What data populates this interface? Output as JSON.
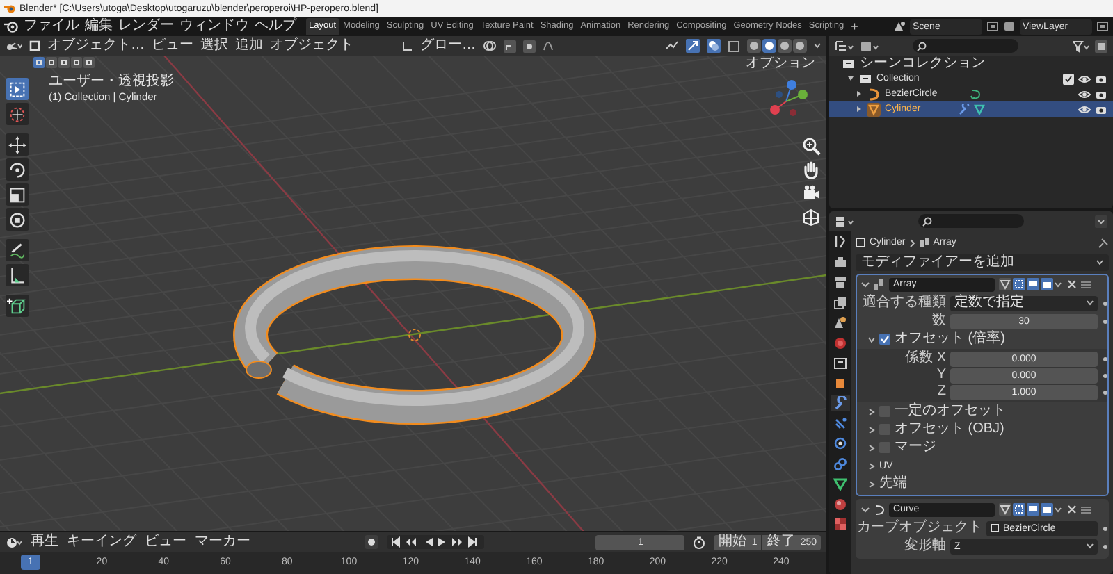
{
  "window": {
    "title": "Blender* [C:\\Users\\utoga\\Desktop\\utogaruzu\\blender\\peroperoi\\HP-peropero.blend]"
  },
  "menu": [
    "ファイル",
    "編集",
    "レンダー",
    "ウィンドウ",
    "ヘルプ"
  ],
  "workspaces": [
    {
      "label": "Layout",
      "selected": true
    },
    {
      "label": "Modeling",
      "selected": false
    },
    {
      "label": "Sculpting",
      "selected": false
    },
    {
      "label": "UV Editing",
      "selected": false
    },
    {
      "label": "Texture Paint",
      "selected": false
    },
    {
      "label": "Shading",
      "selected": false
    },
    {
      "label": "Animation",
      "selected": false
    },
    {
      "label": "Rendering",
      "selected": false
    },
    {
      "label": "Compositing",
      "selected": false
    },
    {
      "label": "Geometry Nodes",
      "selected": false
    },
    {
      "label": "Scripting",
      "selected": false
    }
  ],
  "add_workspace": "+",
  "scene": "Scene",
  "view_layer": "ViewLayer",
  "viewport": {
    "mode": "オブジェクト…",
    "menus": [
      "ビュー",
      "選択",
      "追加",
      "オブジェクト"
    ],
    "orientation": "グロー…",
    "options": "オプション",
    "info": [
      "ユーザー・透視投影",
      "(1) Collection | Cylinder"
    ],
    "select_modes": [
      {
        "selected": true
      },
      {
        "selected": false
      },
      {
        "selected": false
      },
      {
        "selected": false
      },
      {
        "selected": false
      }
    ],
    "shading_modes": [
      {
        "selected": false
      },
      {
        "selected": true
      },
      {
        "selected": false
      },
      {
        "selected": false
      }
    ],
    "tools": [
      {
        "kind": "select",
        "selected": true
      },
      {
        "kind": "cursor",
        "selected": false
      },
      {
        "kind": "move",
        "selected": false
      },
      {
        "kind": "rotate",
        "selected": false
      },
      {
        "kind": "scale",
        "selected": false
      },
      {
        "kind": "transform",
        "selected": false
      },
      {
        "kind": "annotate",
        "selected": false
      },
      {
        "kind": "measure",
        "selected": false
      },
      {
        "kind": "add_cube",
        "selected": false
      }
    ]
  },
  "outliner": {
    "items": [
      {
        "label": "シーンコレクション",
        "kind": "scene_collection",
        "children": [
          {
            "label": "Collection",
            "kind": "collection",
            "children": [
              {
                "label": "BezierCircle",
                "kind": "curve",
                "selected": false
              },
              {
                "label": "Cylinder",
                "kind": "mesh",
                "selected": true
              }
            ]
          }
        ]
      }
    ]
  },
  "properties": {
    "tabs": [
      {
        "kind": "tool",
        "selected": false
      },
      {
        "kind": "render",
        "selected": false
      },
      {
        "kind": "output",
        "selected": false
      },
      {
        "kind": "view_layer",
        "selected": false
      },
      {
        "kind": "scene",
        "selected": false
      },
      {
        "kind": "world",
        "selected": false
      },
      {
        "kind": "collection",
        "selected": false
      },
      {
        "kind": "object",
        "selected": false
      },
      {
        "kind": "modifier",
        "selected": true
      },
      {
        "kind": "particles",
        "selected": false
      },
      {
        "kind": "physics",
        "selected": false
      },
      {
        "kind": "constraints",
        "selected": false
      },
      {
        "kind": "data",
        "selected": false
      },
      {
        "kind": "material",
        "selected": false
      },
      {
        "kind": "texture",
        "selected": false
      }
    ],
    "breadcrumb": [
      "Cylinder",
      "Array"
    ],
    "add_modifier": "モディファイアーを追加",
    "modifiers": [
      {
        "name": "Array",
        "kind": "array",
        "active": true,
        "rows": [
          {
            "kind": "dropdown",
            "label": "適合する種類",
            "value": "定数で指定"
          },
          {
            "kind": "number",
            "label": "数",
            "value": "30"
          }
        ],
        "subpanels": [
          {
            "label": "オフセット (倍率)",
            "checkbox": true,
            "checked": true,
            "expanded": true,
            "rows": [
              {
                "kind": "number",
                "label": "係数 X",
                "value": "0.000"
              },
              {
                "kind": "number",
                "label": "Y",
                "value": "0.000"
              },
              {
                "kind": "number",
                "label": "Z",
                "value": "1.000"
              }
            ]
          },
          {
            "label": "一定のオフセット",
            "checkbox": true,
            "checked": false,
            "expanded": false
          },
          {
            "label": "オフセット (OBJ)",
            "checkbox": true,
            "checked": false,
            "expanded": false
          },
          {
            "label": "マージ",
            "checkbox": true,
            "checked": false,
            "expanded": false
          },
          {
            "label": "UV",
            "checkbox": false,
            "expanded": false
          },
          {
            "label": "先端",
            "checkbox": false,
            "expanded": false
          }
        ]
      },
      {
        "name": "Curve",
        "kind": "curve",
        "active": false,
        "rows": [
          {
            "kind": "object",
            "label": "カーブオブジェクト",
            "value": "BezierCircle"
          },
          {
            "kind": "dropdown",
            "label": "変形軸",
            "value": "Z"
          }
        ]
      }
    ]
  },
  "timeline": {
    "menus": [
      "再生",
      "キーイング",
      "ビュー",
      "マーカー"
    ],
    "current_frame": "1",
    "start_label": "開始",
    "start": "1",
    "end_label": "終了",
    "end": "250",
    "playhead": "1",
    "ticks": [
      "20",
      "40",
      "60",
      "80",
      "100",
      "120",
      "140",
      "160",
      "180",
      "200",
      "220",
      "240"
    ]
  }
}
